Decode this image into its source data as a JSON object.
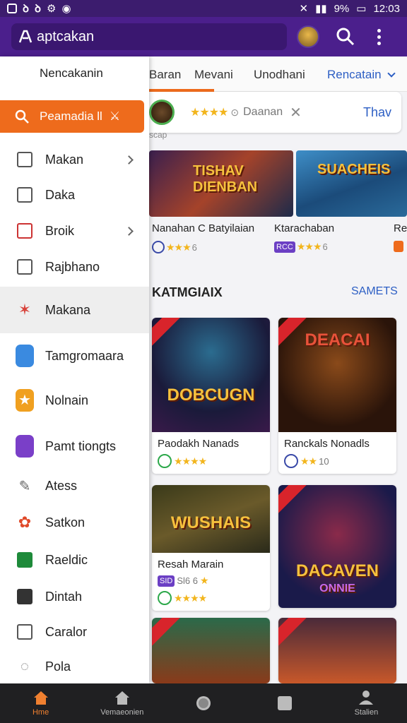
{
  "status_bar": {
    "time": "12:03",
    "battery": "9%",
    "left_icons": [
      "image-icon",
      "notification-icon",
      "notification-icon",
      "settings-icon",
      "game-icon"
    ]
  },
  "app_bar": {
    "search_text": "aptcakan",
    "icons": [
      "logo-icon",
      "avatar",
      "search-icon",
      "more-icon"
    ]
  },
  "tabs": [
    {
      "label": "Baran",
      "active": true
    },
    {
      "label": "Mevani",
      "active": false
    },
    {
      "label": "Unodhani",
      "active": false
    },
    {
      "label": "Rencatain",
      "active": false
    }
  ],
  "promo": {
    "text": "Daanan",
    "action": "Thav",
    "rating_stars": 4
  },
  "scroll_hint": "scap",
  "featured": {
    "banners": [
      {
        "title": "TISHAV DIENBAN"
      },
      {
        "title": "SUACHEIS"
      }
    ],
    "items": [
      {
        "title": "Nanahan C Batyilaian",
        "rating": "6"
      },
      {
        "title": "Ktarachaban",
        "chip": "RCC",
        "rating": "6"
      },
      {
        "title": "Re"
      }
    ]
  },
  "section": {
    "title": "KATMGIAIX",
    "more": "SAMETS"
  },
  "cards": [
    {
      "art_title": "DOBCUGN",
      "title": "Paodakh Nanads",
      "rating": ""
    },
    {
      "art_title": "DEACAI",
      "title": "Ranckals Nonadls",
      "rating": "10"
    },
    {
      "art_title": "WUSHAIS",
      "title": "Resah Marain",
      "chip": "SID",
      "chip_text": "Sl6 6",
      "rating": ""
    },
    {
      "art_title": "DACAVEN",
      "art_subtitle": "ONNIE",
      "title": "",
      "rating": ""
    }
  ],
  "drawer": {
    "header": "Nencakanin",
    "search_label": "Peamadia ll",
    "items": [
      {
        "label": "Makan",
        "icon": "document-icon",
        "has_arrow": true
      },
      {
        "label": "Daka",
        "icon": "file-icon",
        "has_arrow": false
      },
      {
        "label": "Broik",
        "icon": "edit-icon",
        "has_arrow": true
      },
      {
        "label": "Rajbhano",
        "icon": "folder-icon",
        "has_arrow": false
      },
      {
        "label": "Makana",
        "icon": "game-icon",
        "has_arrow": false,
        "active": true
      },
      {
        "label": "Tamgromaara",
        "icon": "gamepad-icon",
        "has_arrow": false
      },
      {
        "label": "Nolnain",
        "icon": "star-icon",
        "has_arrow": false
      },
      {
        "label": "Pamt tiongts",
        "icon": "music-icon",
        "has_arrow": false
      },
      {
        "label": "Atess",
        "icon": "brush-icon",
        "has_arrow": false
      },
      {
        "label": "Satkon",
        "icon": "palette-icon",
        "has_arrow": false
      },
      {
        "label": "Raeldic",
        "icon": "sheet-icon",
        "has_arrow": false
      },
      {
        "label": "Dintah",
        "icon": "plus-box-icon",
        "has_arrow": false
      },
      {
        "label": "Caralor",
        "icon": "square-icon",
        "has_arrow": false
      },
      {
        "label": "Pola",
        "icon": "chat-icon",
        "has_arrow": false
      }
    ]
  },
  "bottom_nav": [
    {
      "label": "Hme",
      "icon": "home-icon",
      "active": true
    },
    {
      "label": "Vemaeonien",
      "icon": "home-outline-icon",
      "active": false
    },
    {
      "label": "",
      "icon": "circle-icon",
      "active": false
    },
    {
      "label": "",
      "icon": "square-icon",
      "active": false
    },
    {
      "label": "Stalien",
      "icon": "person-icon",
      "active": false
    }
  ],
  "colors": {
    "app_bar": "#4b1f8c",
    "accent": "#ee6b1c",
    "link": "#2d5fc4",
    "star": "#f2b51d"
  }
}
